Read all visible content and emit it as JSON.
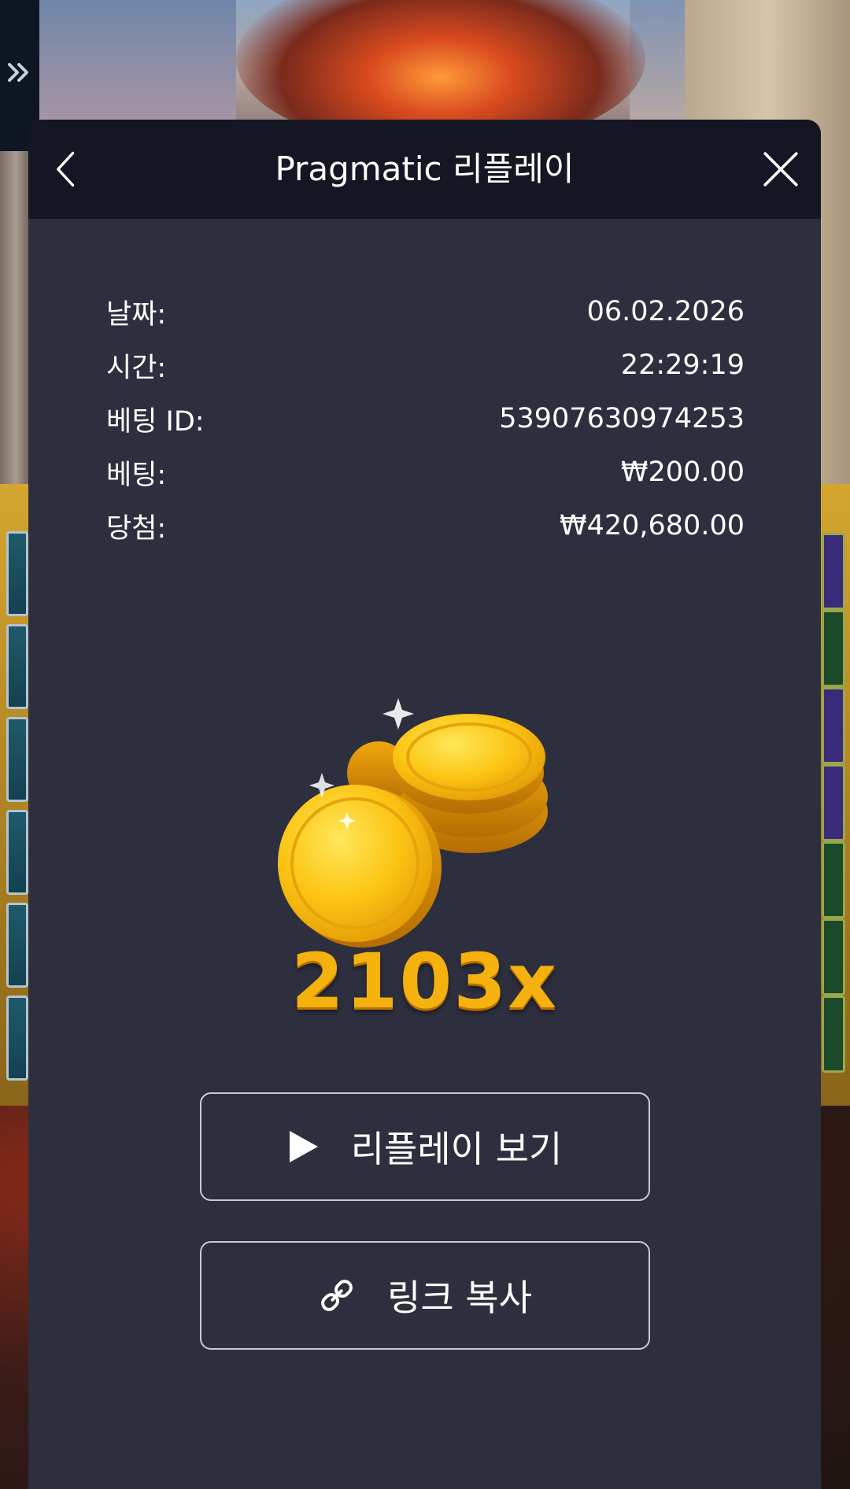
{
  "modal": {
    "title": "Pragmatic 리플레이",
    "back_icon": "chevron-left-icon",
    "close_icon": "close-icon"
  },
  "bet_info": [
    {
      "label": "날짜:",
      "value": "06.02.2026"
    },
    {
      "label": "시간:",
      "value": "22:29:19"
    },
    {
      "label": "베팅 ID:",
      "value": "53907630974253"
    },
    {
      "label": "베팅:",
      "value": "₩200.00"
    },
    {
      "label": "당첨:",
      "value": "₩420,680.00"
    }
  ],
  "win": {
    "multiplier": "2103x",
    "illustration_icon": "gold-coins-icon"
  },
  "actions": {
    "replay_label": "리플레이 보기",
    "replay_icon": "play-icon",
    "copy_label": "링크 복사",
    "copy_icon": "link-icon"
  },
  "side_tab": {
    "icon": "double-chevron-right-icon"
  },
  "colors": {
    "panel_bg": "#2d2f3e",
    "header_bg": "#141723",
    "multiplier_gold": "#f5b20f",
    "button_border": "#c9cbd4"
  }
}
